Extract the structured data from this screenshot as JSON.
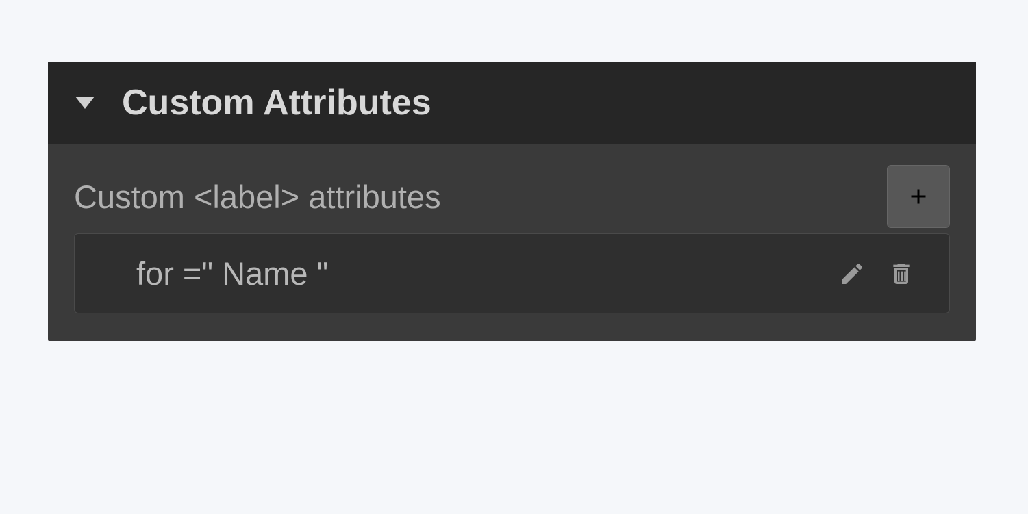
{
  "panel": {
    "title": "Custom Attributes",
    "sub_label": "Custom <label> attributes",
    "attributes": [
      {
        "display": "for =\" Name \""
      }
    ]
  }
}
